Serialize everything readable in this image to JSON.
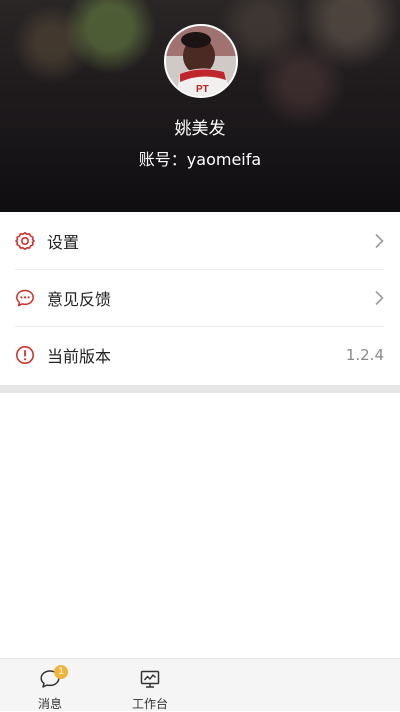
{
  "profile": {
    "name": "姚美发",
    "account": "账号：yaomeifa",
    "avatar_icon": "user-avatar-photo"
  },
  "menu": {
    "items": [
      {
        "label": "设置",
        "icon": "gear-icon",
        "trailing": "chevron-right-icon"
      },
      {
        "label": "意见反馈",
        "icon": "chat-bubble-dots-icon",
        "trailing": "chevron-right-icon"
      },
      {
        "label": "当前版本",
        "icon": "info-circle-icon",
        "value": "1.2.4"
      }
    ],
    "icon_color": "#d0312d"
  },
  "tabbar": {
    "tabs": [
      {
        "label": "消息",
        "icon": "message-bubble-icon",
        "badge": "1"
      },
      {
        "label": "工作台",
        "icon": "monitor-chart-icon"
      }
    ],
    "badge_color": "#f0b43c"
  }
}
